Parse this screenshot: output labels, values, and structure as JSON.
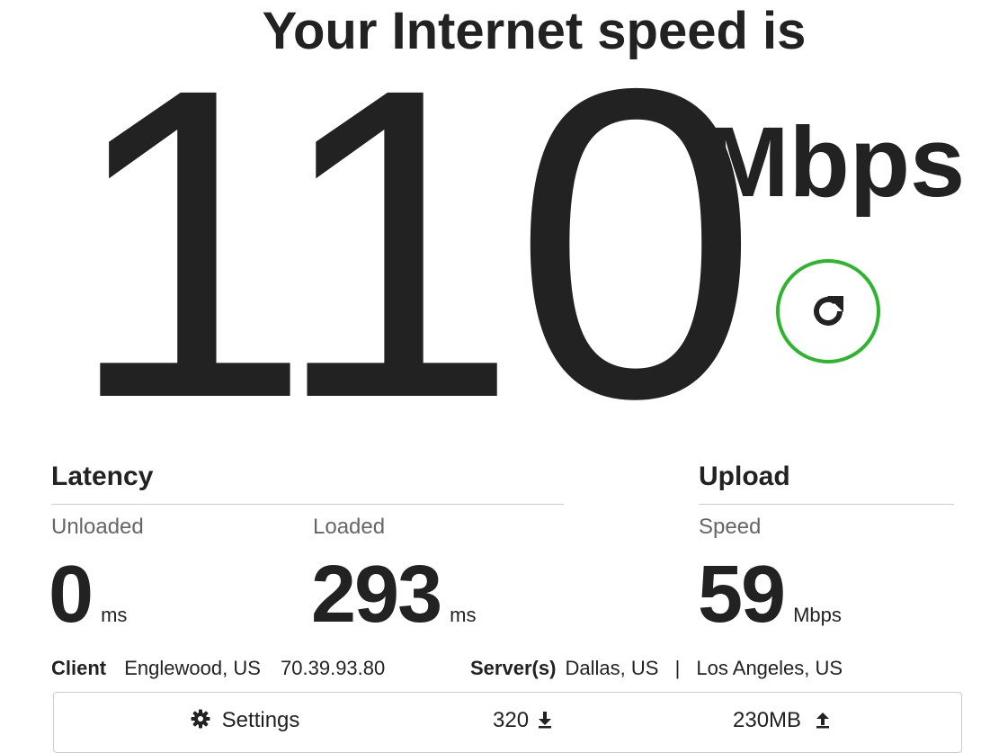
{
  "headline": "Your Internet speed is",
  "download": {
    "value": "110",
    "unit": "Mbps"
  },
  "refresh": {
    "icon": "refresh-icon",
    "ring_color": "#2db52d"
  },
  "latency": {
    "title": "Latency",
    "unloaded": {
      "label": "Unloaded",
      "value": "0",
      "unit": "ms"
    },
    "loaded": {
      "label": "Loaded",
      "value": "293",
      "unit": "ms"
    }
  },
  "upload": {
    "title": "Upload",
    "label": "Speed",
    "value": "59",
    "unit": "Mbps"
  },
  "client": {
    "label": "Client",
    "location": "Englewood, US",
    "ip": "70.39.93.80"
  },
  "servers": {
    "label": "Server(s)",
    "primary": "Dallas, US",
    "separator": "|",
    "secondary": "Los Angeles, US"
  },
  "footer": {
    "settings_label": "Settings",
    "settings_icon": "gear-icon",
    "download_size": "320",
    "download_icon": "download-arrow-icon",
    "upload_size": "230MB",
    "upload_icon": "upload-arrow-icon"
  }
}
